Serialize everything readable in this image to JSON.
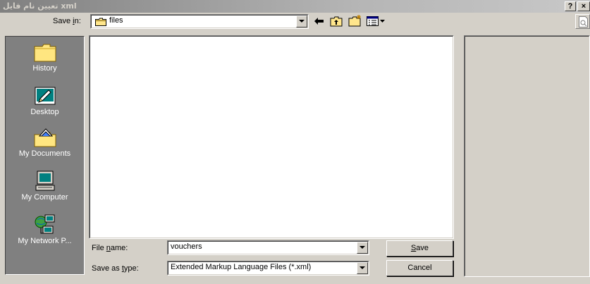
{
  "window": {
    "title": "تعیین نام فایل xml",
    "help_label": "?",
    "close_label": "×"
  },
  "save_in": {
    "label_prefix": "Save ",
    "label_key": "i",
    "label_suffix": "n:",
    "value": "files"
  },
  "toolbar": {
    "icons": [
      "back-arrow-icon",
      "up-one-level-icon",
      "create-new-folder-icon",
      "views-menu-icon"
    ]
  },
  "places": [
    {
      "label": "History",
      "icon": "history-folder-icon"
    },
    {
      "label": "Desktop",
      "icon": "desktop-icon"
    },
    {
      "label": "My Documents",
      "icon": "my-documents-icon"
    },
    {
      "label": "My Computer",
      "icon": "my-computer-icon"
    },
    {
      "label": "My Network P...",
      "icon": "my-network-places-icon"
    }
  ],
  "file_name": {
    "label_prefix": "File ",
    "label_key": "n",
    "label_suffix": "ame:",
    "value": "vouchers"
  },
  "save_as_type": {
    "label_prefix": "Save as ",
    "label_key": "t",
    "label_suffix": "ype:",
    "value": "Extended Markup Language Files (*.xml)"
  },
  "buttons": {
    "save_key": "S",
    "save_rest": "ave",
    "cancel": "Cancel"
  }
}
